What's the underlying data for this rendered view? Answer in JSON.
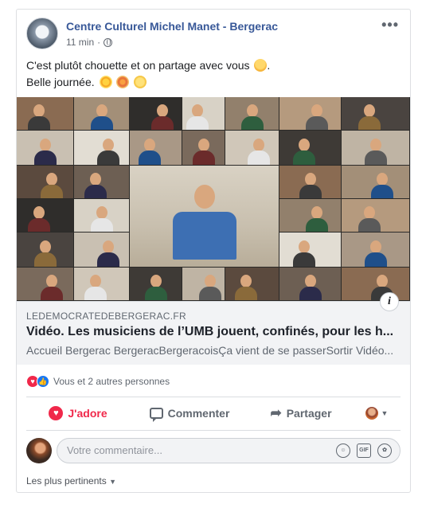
{
  "post": {
    "page_name": "Centre Culturel Michel Manet - Bergerac",
    "time": "11 min",
    "privacy_icon": "globe-icon",
    "text_line1": "C'est plutôt chouette et on partage avec vous",
    "text_line2": "Belle journée."
  },
  "link": {
    "domain": "LEDEMOCRATEDEBERGERAC.FR",
    "title": "Vidéo. Les musiciens de l’UMB jouent, confinés, pour les h...",
    "description": "Accueil Bergerac BergeracBergeracoisÇa vient de se passerSortir Vidéo..."
  },
  "reactions": {
    "summary": "Vous et 2 autres personnes"
  },
  "actions": {
    "adore": "J'adore",
    "comment": "Commenter",
    "share": "Partager"
  },
  "comment": {
    "placeholder": "Votre commentaire..."
  },
  "sort_label": "Les plus pertinents",
  "colors": {
    "brand_link": "#385898",
    "love": "#f0284a",
    "like": "#1877f2"
  }
}
